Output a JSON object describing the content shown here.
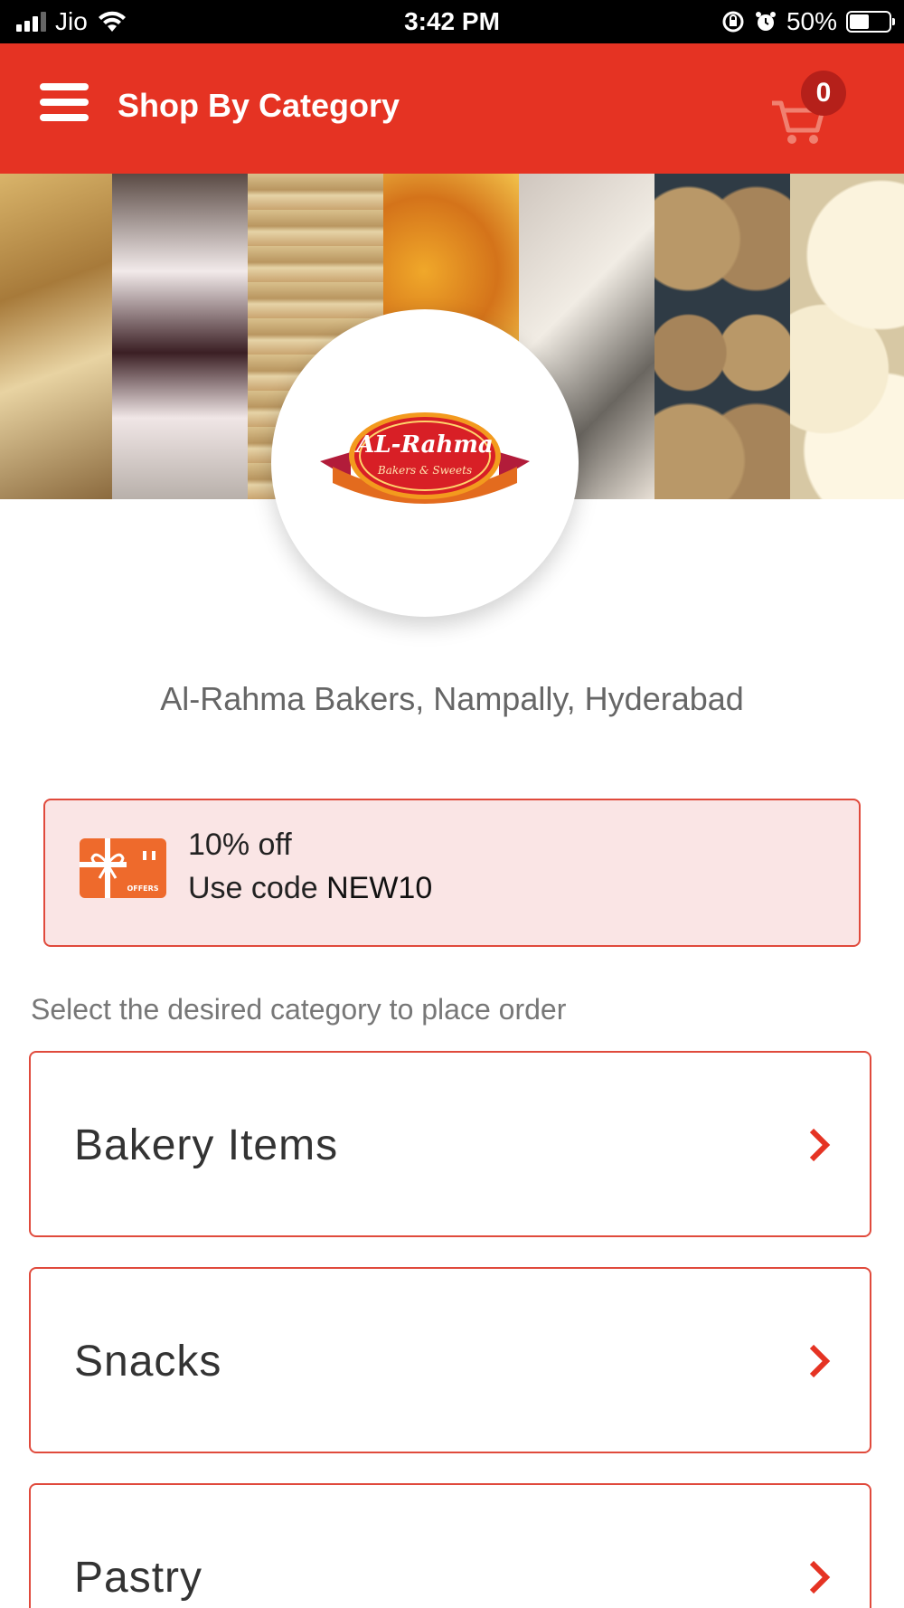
{
  "status_bar": {
    "carrier": "Jio",
    "time": "3:42 PM",
    "battery": "50%"
  },
  "header": {
    "title": "Shop By Category",
    "cart_count": "0"
  },
  "logo": {
    "brand": "AL-Rahma",
    "tagline": "Bakers & Sweets"
  },
  "store": {
    "name": "Al-Rahma Bakers, Nampally, Hyderabad"
  },
  "offer": {
    "discount": "10% off",
    "code_prefix": "Use code ",
    "code": "NEW10",
    "icon_text": "OFFERS"
  },
  "instruction": "Select the desired category to place order",
  "categories": [
    {
      "label": "Bakery Items"
    },
    {
      "label": "Snacks"
    },
    {
      "label": "Pastry"
    }
  ],
  "colors": {
    "primary": "#e53323",
    "offer_bg": "#fae5e5",
    "offer_icon": "#ee6a2c"
  }
}
